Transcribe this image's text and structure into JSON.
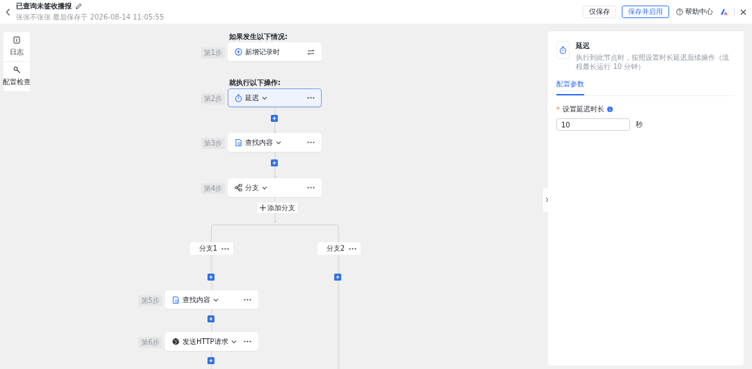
{
  "header": {
    "title": "已查询未签收播报",
    "subtitle": "张张不张张 最后保存于 2026-08-14 11:05:55"
  },
  "header_buttons": [
    {
      "label": "仅保存",
      "kind": "plain"
    },
    {
      "label": "保存并启用",
      "kind": "primary"
    },
    {
      "label": "帮助中心",
      "kind": "help"
    }
  ],
  "tools": [
    {
      "label": "日志",
      "kind": "log"
    },
    {
      "label": "配置检查",
      "kind": "check"
    }
  ],
  "flow": {
    "trigger_heading": "如果发生以下情况:",
    "action_heading": "就执行以下操作:",
    "add_branch": "添加分支",
    "steps": [
      {
        "step": "第1步",
        "title": "新增记录时",
        "kind": "trigger",
        "selected": false
      },
      {
        "step": "第2步",
        "title": "延迟",
        "kind": "delay",
        "selected": true
      },
      {
        "step": "第3步",
        "title": "查找内容",
        "kind": "search",
        "selected": false
      },
      {
        "step": "第4步",
        "title": "分支",
        "kind": "branch",
        "selected": false
      },
      {
        "step": "第5步",
        "title": "查找内容",
        "kind": "search",
        "selected": false
      },
      {
        "step": "第6步",
        "title": "发送HTTP请求",
        "kind": "http",
        "selected": false
      }
    ],
    "branches": [
      {
        "label": "分支1"
      },
      {
        "label": "分支2"
      }
    ]
  },
  "panel": {
    "title": "延迟",
    "description": "执行到此节点时，按照设置时长延迟后续操作（流程最长运行 10 分钟）",
    "tabs": [
      {
        "label": "配置参数",
        "selected": true
      }
    ],
    "field": {
      "label": "设置延迟时长",
      "required": true,
      "required_mark": "*",
      "value": "10",
      "unit": "秒"
    }
  }
}
